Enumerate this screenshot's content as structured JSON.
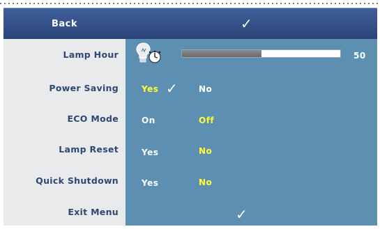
{
  "header": {
    "back_label": "Back",
    "check_glyph": "✓"
  },
  "rows": {
    "lamp_hour": {
      "label": "Lamp Hour",
      "value": "50",
      "progress_fraction": 0.5
    },
    "power_saving": {
      "label": "Power Saving",
      "option_yes": "Yes",
      "option_no": "No",
      "check_glyph": "✓",
      "selected": "Yes"
    },
    "eco_mode": {
      "label": "ECO Mode",
      "option_on": "On",
      "option_off": "Off",
      "selected": "Off"
    },
    "lamp_reset": {
      "label": "Lamp Reset",
      "option_yes": "Yes",
      "option_no": "No",
      "selected": "No"
    },
    "quick_shutdown": {
      "label": "Quick Shutdown",
      "option_yes": "Yes",
      "option_no": "No",
      "selected": "No"
    },
    "exit_menu": {
      "label": "Exit Menu",
      "check_glyph": "✓"
    }
  },
  "icons": {
    "lamp": "lamp-clock-icon",
    "check": "checkmark-icon"
  },
  "colors": {
    "header_bg": "#2f4b82",
    "label_bg": "#e9eaec",
    "value_bg": "#5d8fb2",
    "label_text": "#2f4873",
    "selected_text": "#ffff33",
    "normal_text": "#ffffff"
  }
}
